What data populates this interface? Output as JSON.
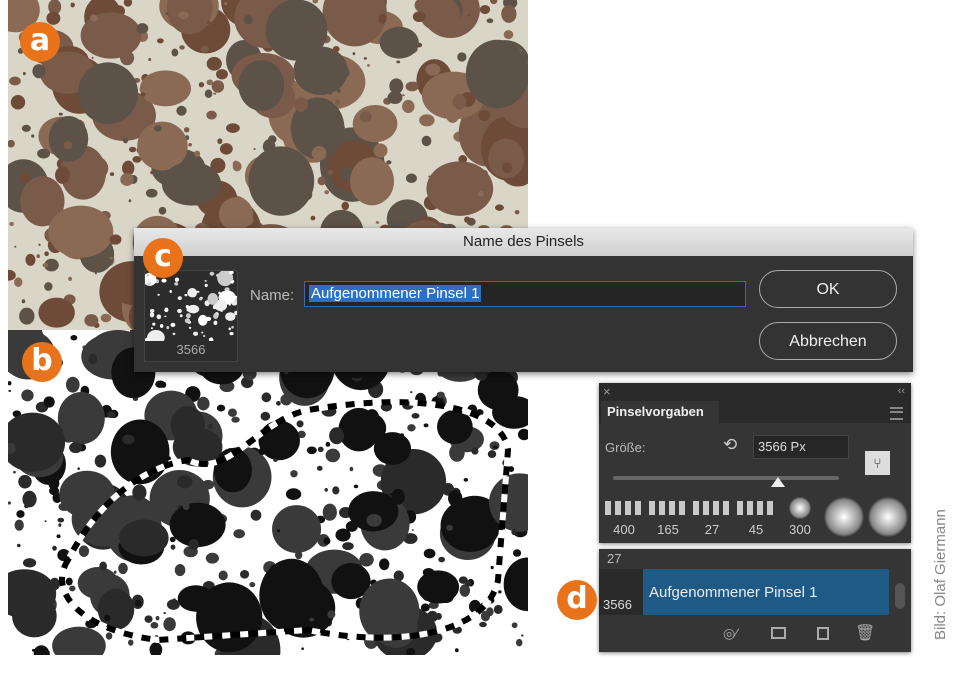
{
  "badges": {
    "a": "a",
    "b": "b",
    "c": "c",
    "d": "d"
  },
  "dialog": {
    "title": "Name des Pinsels",
    "thumb_size": "3566",
    "name_label": "Name:",
    "name_value": "Aufgenommener Pinsel 1",
    "ok": "OK",
    "cancel": "Abbrechen"
  },
  "panel": {
    "close": "×",
    "collapse": "‹‹",
    "tab": "Pinselvorgaben",
    "size_label": "Größe:",
    "size_value": "3566 Px",
    "size_fraction": 0.73,
    "presets": [
      "400",
      "165",
      "27",
      "45",
      "300",
      "",
      ""
    ],
    "list": {
      "prev_size": "27",
      "selected_size": "3566",
      "selected_name": "Aufgenommener Pinsel 1"
    },
    "footer_icons": [
      "toggle-visibility-icon",
      "brush-options-icon",
      "new-preset-icon",
      "trash-icon"
    ]
  },
  "credit": "Bild: Olaf Giermann",
  "colors": {
    "accent": "#e8731a",
    "selection": "#1f5a86"
  }
}
